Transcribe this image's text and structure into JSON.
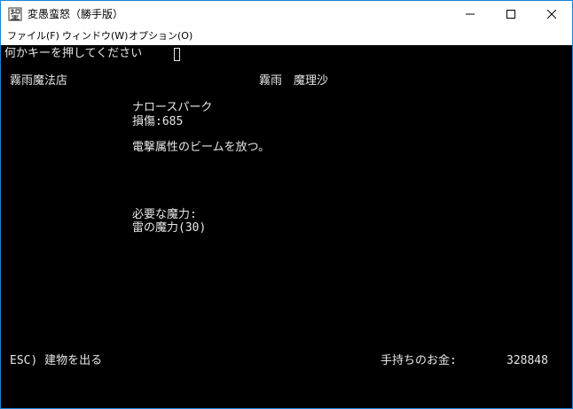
{
  "window": {
    "title": "変愚蛮怒（勝手版）",
    "app_icon": "game-app-icon",
    "controls": {
      "minimize": "minimize-icon",
      "maximize": "maximize-icon",
      "close": "close-icon"
    }
  },
  "menu": {
    "items": [
      {
        "label": "ファイル(F)"
      },
      {
        "label": "ウィンドウ(W)"
      },
      {
        "label": "オプション(O)"
      }
    ]
  },
  "console": {
    "prompt": "何かキーを押してください",
    "shop_name": "霧雨魔法店",
    "owner_name": "霧雨　魔理沙",
    "spell": {
      "name": "ナロースパーク",
      "damage": "損傷:685",
      "description": "電撃属性のビームを放つ。"
    },
    "requirement": {
      "heading": "必要な魔力:",
      "value": "雷の魔力(30)"
    },
    "footer": {
      "esc_hint": "ESC) 建物を出る",
      "gold_label": "手持ちのお金:",
      "gold_value": "328848"
    },
    "colors": {
      "background": "#000000",
      "text": "#e6e6e6"
    }
  }
}
